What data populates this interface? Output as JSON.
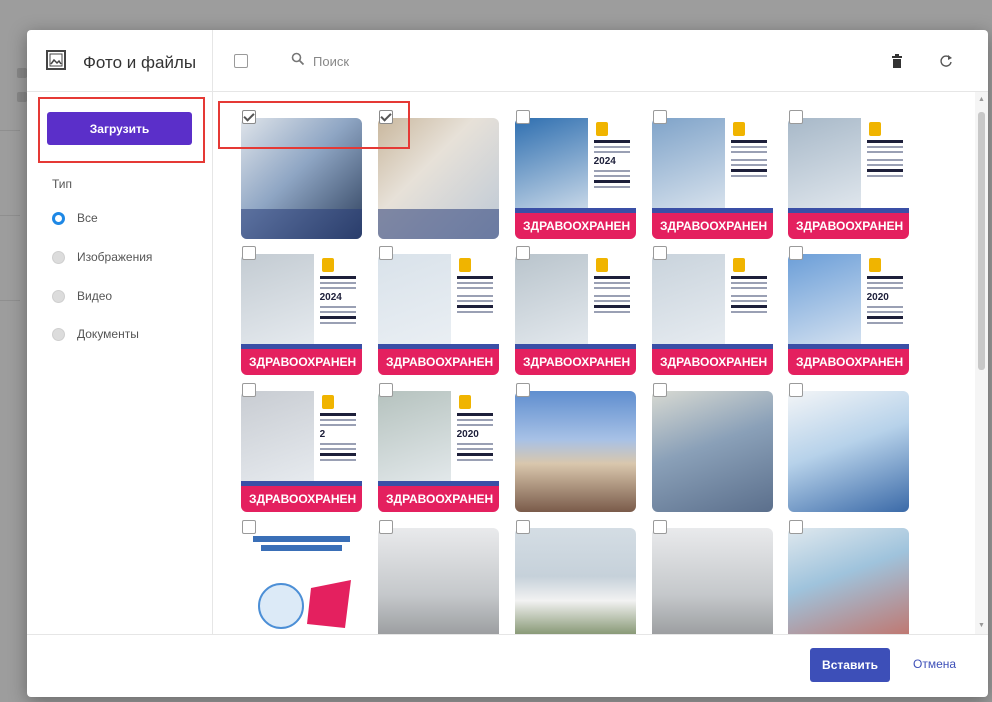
{
  "header": {
    "title": "Фото и файлы",
    "search_placeholder": "Поиск"
  },
  "sidebar": {
    "upload_label": "Загрузить",
    "filter_title": "Тип",
    "filters": [
      {
        "label": "Все",
        "checked": true
      },
      {
        "label": "Изображения",
        "checked": false
      },
      {
        "label": "Видео",
        "checked": false
      },
      {
        "label": "Документы",
        "checked": false
      }
    ]
  },
  "grid": {
    "band_text": "ЗДРАВООХРАНЕН",
    "tiles": [
      {
        "kind": "portrait",
        "checked": true
      },
      {
        "kind": "nurse",
        "checked": true
      },
      {
        "kind": "poster",
        "photo": "#2f6fb0",
        "big": "2024",
        "checked": false
      },
      {
        "kind": "poster",
        "photo": "#7fa3c9",
        "big": "",
        "checked": false
      },
      {
        "kind": "poster",
        "photo": "#a7b8c8",
        "big": "",
        "checked": false
      },
      {
        "kind": "poster",
        "photo": "#c3cbd2",
        "big": "2024",
        "checked": false
      },
      {
        "kind": "poster",
        "photo": "#d9e2ea",
        "big": "",
        "checked": false
      },
      {
        "kind": "poster",
        "photo": "#b9c4cc",
        "big": "",
        "checked": false
      },
      {
        "kind": "poster",
        "photo": "#c9d3dc",
        "big": "",
        "checked": false
      },
      {
        "kind": "poster",
        "photo": "#6b9ed8",
        "big": "2020",
        "checked": false
      },
      {
        "kind": "poster",
        "photo": "#c8ccd2",
        "big": "2",
        "checked": false
      },
      {
        "kind": "poster",
        "photo": "#b5c2be",
        "big": "2020",
        "checked": false
      },
      {
        "kind": "building",
        "checked": false
      },
      {
        "kind": "people",
        "checked": false
      },
      {
        "kind": "medic",
        "checked": false
      },
      {
        "kind": "week",
        "checked": false
      },
      {
        "kind": "room",
        "checked": false
      },
      {
        "kind": "outdoor",
        "checked": false
      },
      {
        "kind": "room",
        "checked": false
      },
      {
        "kind": "clinic",
        "checked": false
      }
    ]
  },
  "footer": {
    "insert_label": "Вставить",
    "cancel_label": "Отмена"
  },
  "colors": {
    "primary": "#5b2fc9",
    "insert": "#3d4fb8",
    "highlight": "#e53935",
    "band": "#e4205f",
    "radio_checked": "#1e88e5"
  }
}
